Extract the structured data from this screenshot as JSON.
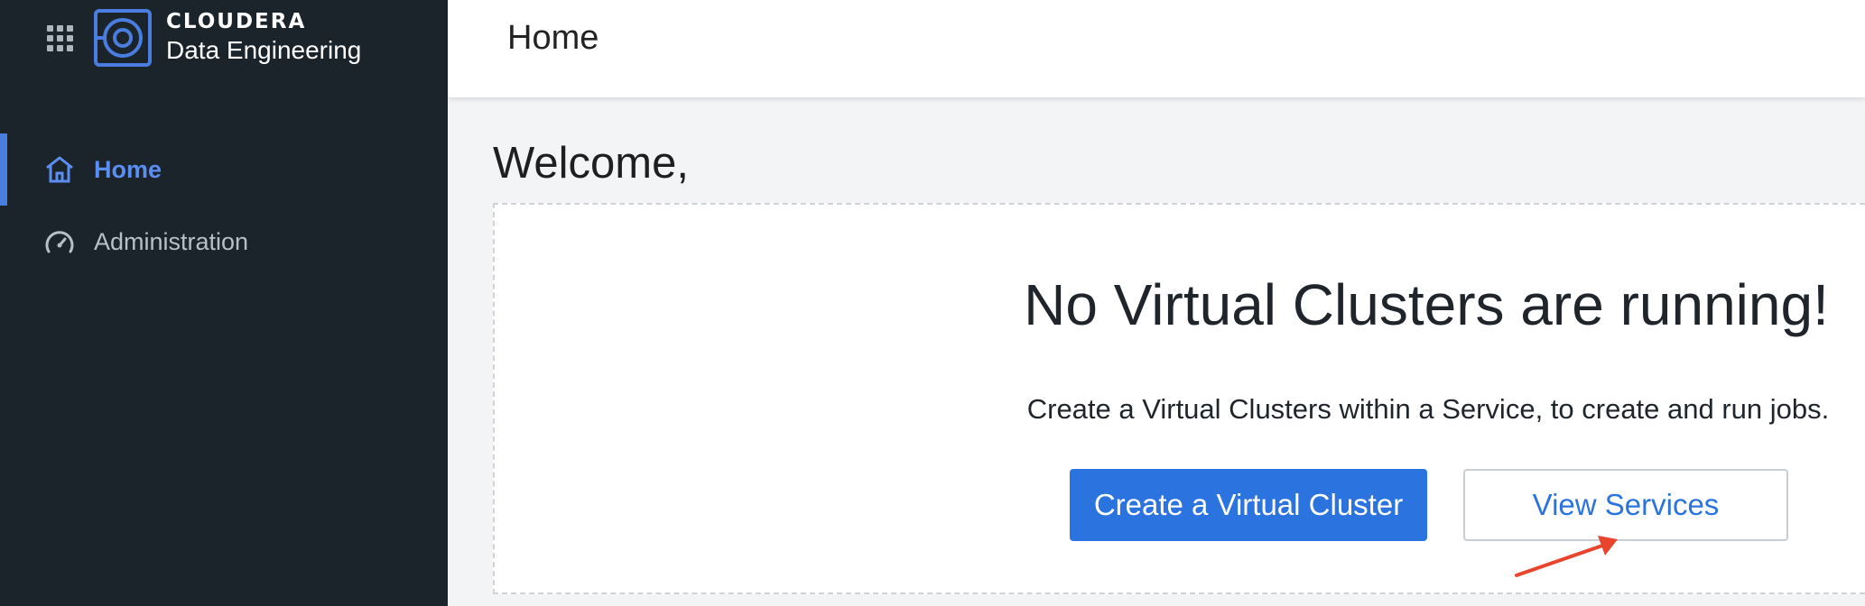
{
  "brand": {
    "name": "CLOUDERA",
    "product": "Data Engineering",
    "accent_color": "#4a7de0",
    "icons": [
      "app-grid-icon",
      "cloudera-logo-icon"
    ]
  },
  "sidebar": {
    "items": [
      {
        "label": "Home",
        "icon": "home-icon",
        "active": true
      },
      {
        "label": "Administration",
        "icon": "speedometer-icon",
        "active": false
      }
    ]
  },
  "header": {
    "title": "Home"
  },
  "main": {
    "welcome": "Welcome,",
    "empty_state": {
      "heading": "No Virtual Clusters are running!",
      "description": "Create a Virtual Clusters within a Service, to create and run jobs.",
      "primary_button": "Create a Virtual Cluster",
      "secondary_button": "View Services",
      "annotation": "arrow-pointing-icon",
      "annotation_color": "#e8452c"
    }
  }
}
